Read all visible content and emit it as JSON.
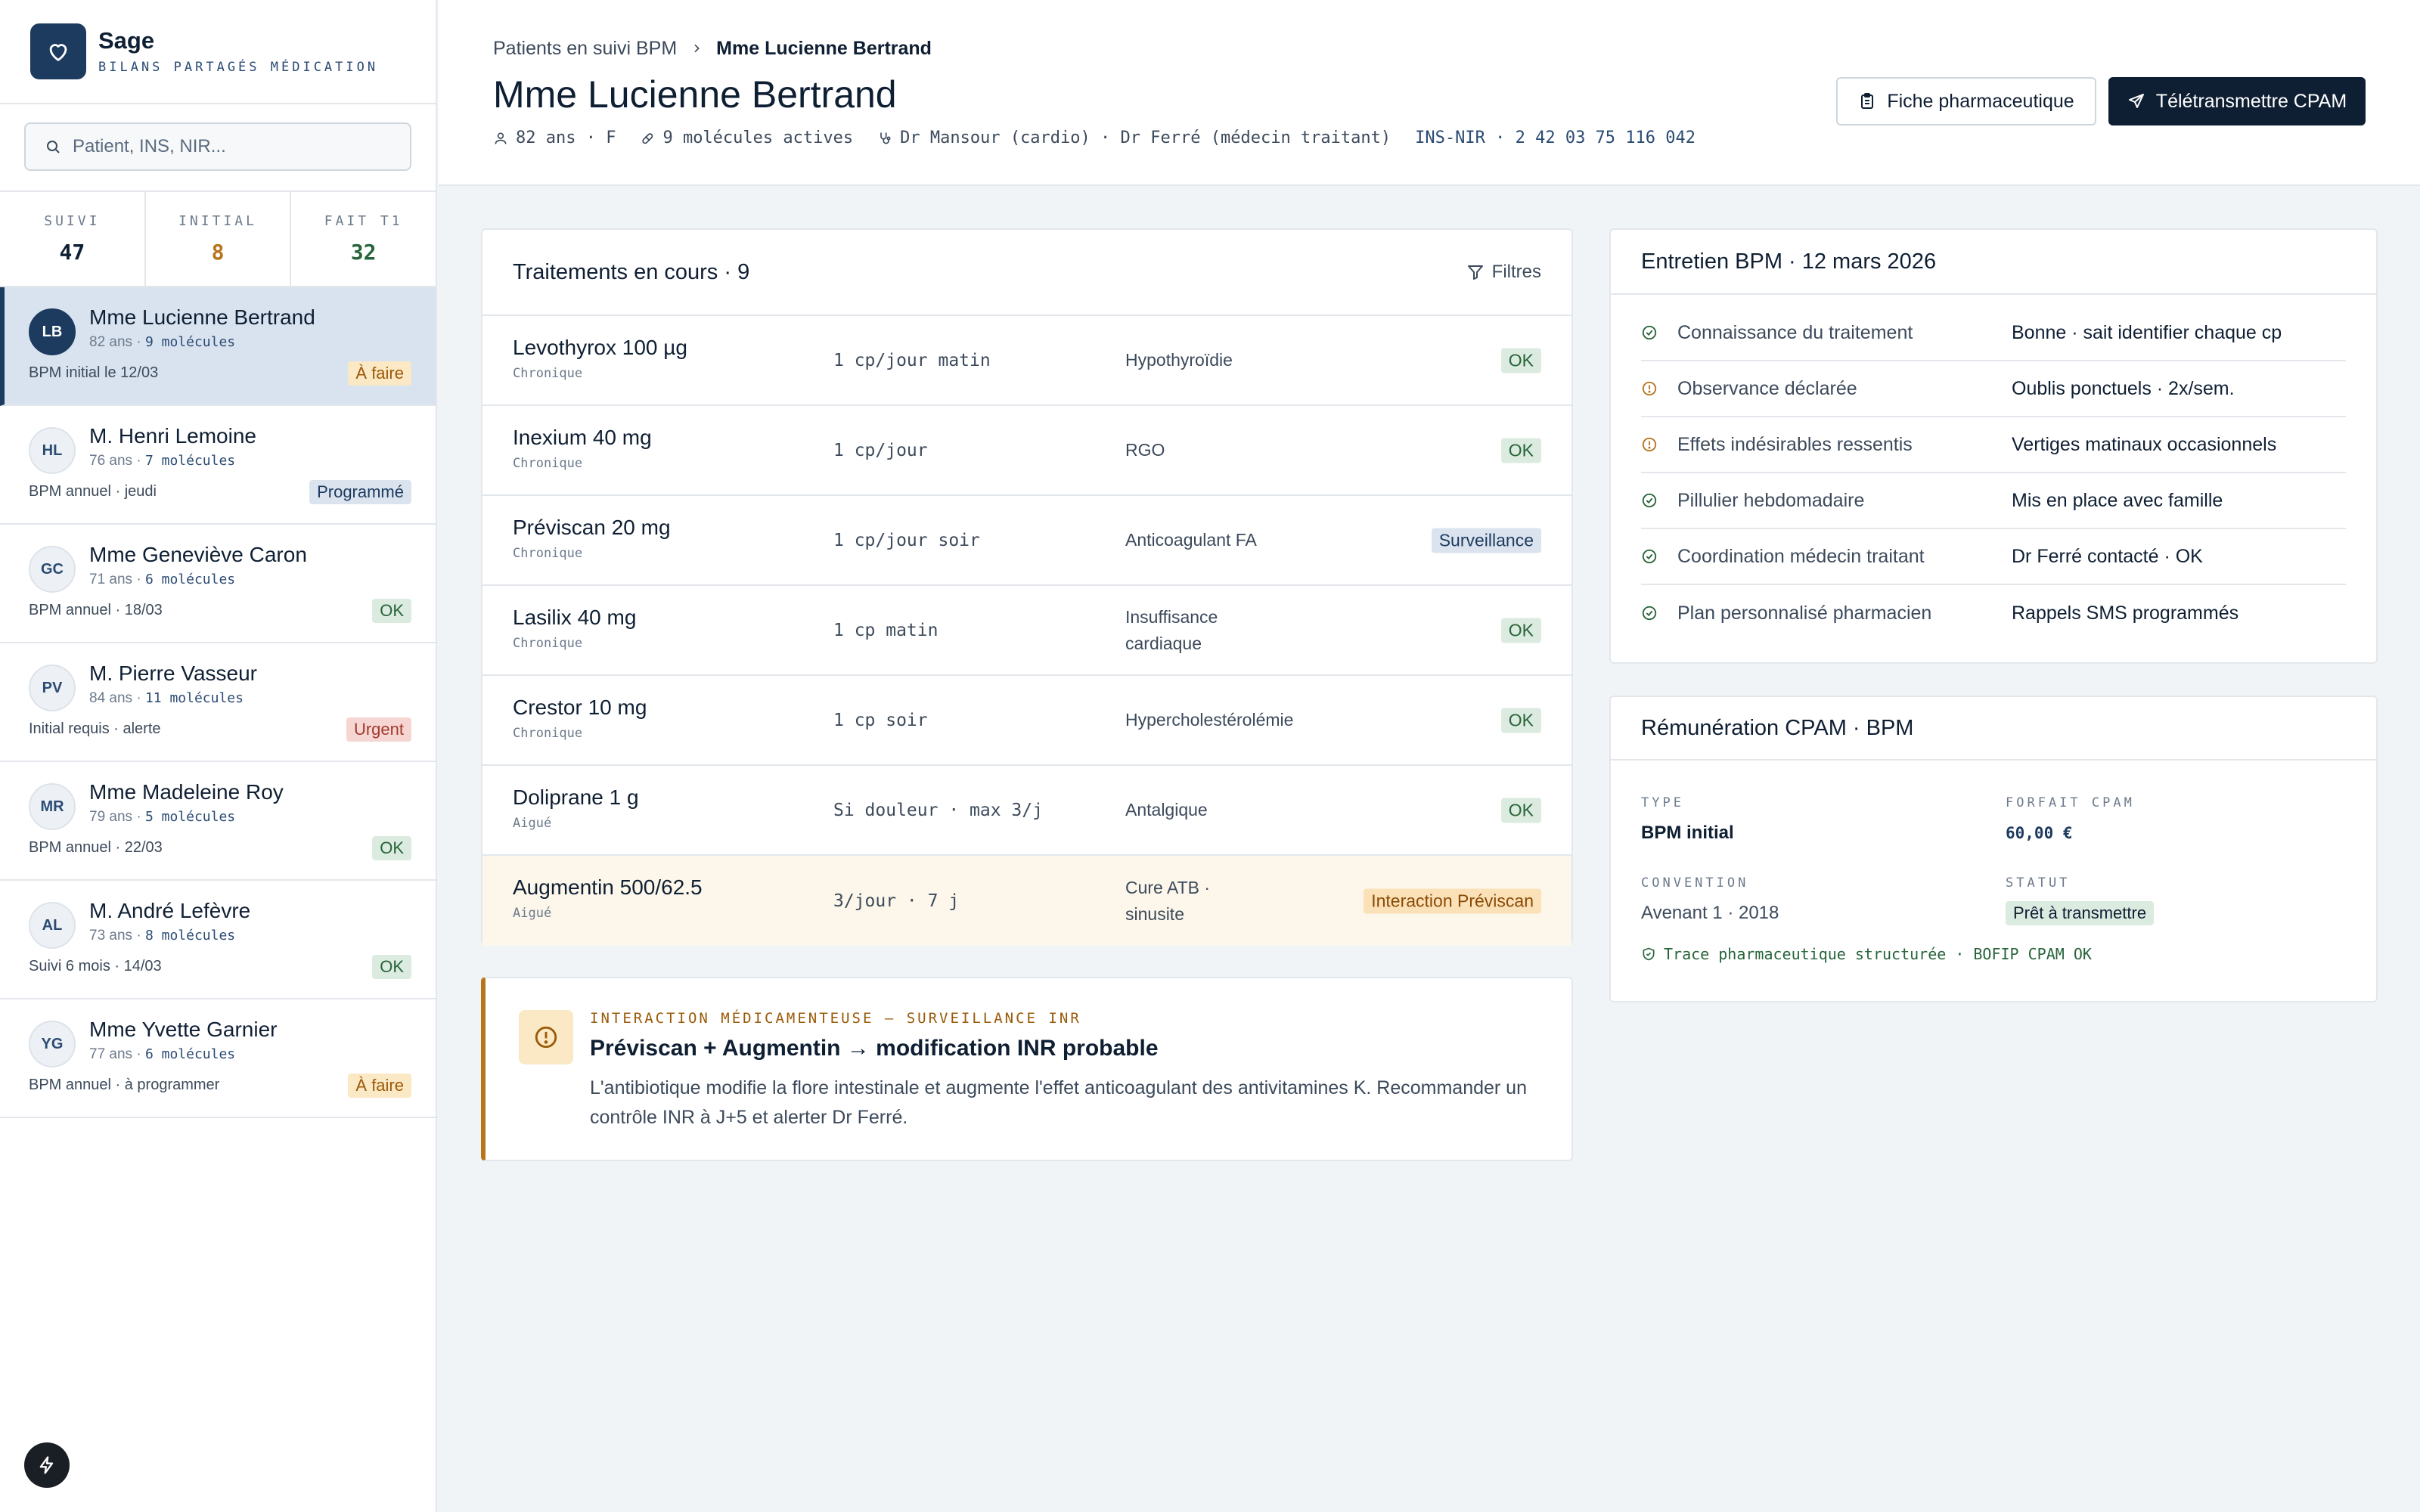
{
  "brand": {
    "name": "Sage",
    "subtitle": "BILANS PARTAGÉS MÉDICATION"
  },
  "search": {
    "placeholder": "Patient, INS, NIR..."
  },
  "stats": [
    {
      "label": "SUIVI",
      "value": "47",
      "color": "#0f1f33"
    },
    {
      "label": "INITIAL",
      "value": "8",
      "color": "#b8741a"
    },
    {
      "label": "FAIT T1",
      "value": "32",
      "color": "#27643a"
    }
  ],
  "patients": [
    {
      "initials": "LB",
      "name": "Mme Lucienne Bertrand",
      "age": "82 ans · ",
      "molecules": "9 molécules",
      "status": "BPM initial le 12/03",
      "badge": "À faire",
      "badge_type": "afaire"
    },
    {
      "initials": "HL",
      "name": "M. Henri Lemoine",
      "age": "76 ans · ",
      "molecules": "7 molécules",
      "status": "BPM annuel · jeudi",
      "badge": "Programmé",
      "badge_type": "prog"
    },
    {
      "initials": "GC",
      "name": "Mme Geneviève Caron",
      "age": "71 ans · ",
      "molecules": "6 molécules",
      "status": "BPM annuel · 18/03",
      "badge": "OK",
      "badge_type": "ok"
    },
    {
      "initials": "PV",
      "name": "M. Pierre Vasseur",
      "age": "84 ans · ",
      "molecules": "11 molécules",
      "status": "Initial requis · alerte",
      "badge": "Urgent",
      "badge_type": "urgent"
    },
    {
      "initials": "MR",
      "name": "Mme Madeleine Roy",
      "age": "79 ans · ",
      "molecules": "5 molécules",
      "status": "BPM annuel · 22/03",
      "badge": "OK",
      "badge_type": "ok"
    },
    {
      "initials": "AL",
      "name": "M. André Lefèvre",
      "age": "73 ans · ",
      "molecules": "8 molécules",
      "status": "Suivi 6 mois · 14/03",
      "badge": "OK",
      "badge_type": "ok"
    },
    {
      "initials": "YG",
      "name": "Mme Yvette Garnier",
      "age": "77 ans · ",
      "molecules": "6 molécules",
      "status": "BPM annuel · à programmer",
      "badge": "À faire",
      "badge_type": "afaire"
    }
  ],
  "header": {
    "breadcrumb_parent": "Patients en suivi BPM",
    "breadcrumb_current": "Mme Lucienne Bertrand",
    "title": "Mme Lucienne Bertrand",
    "meta_age": "82 ans · F",
    "meta_molecules": "9 molécules actives",
    "meta_doctors": "Dr Mansour (cardio) · Dr Ferré (médecin traitant)",
    "meta_ins": "INS-NIR · 2 42 03 75 116 042",
    "btn_fiche": "Fiche pharmaceutique",
    "btn_teletrans": "Télétransmettre CPAM"
  },
  "treatments": {
    "title": "Traitements en cours · 9",
    "filter_label": "Filtres",
    "rows": [
      {
        "name": "Levothyrox 100 µg",
        "kind": "Chronique",
        "dose": "1 cp/jour matin",
        "indication": "Hypothyroïdie",
        "badge": "OK",
        "badge_type": "ok"
      },
      {
        "name": "Inexium 40 mg",
        "kind": "Chronique",
        "dose": "1 cp/jour",
        "indication": "RGO",
        "badge": "OK",
        "badge_type": "ok"
      },
      {
        "name": "Préviscan 20 mg",
        "kind": "Chronique",
        "dose": "1 cp/jour soir",
        "indication": "Anticoagulant FA",
        "badge": "Surveillance",
        "badge_type": "surv"
      },
      {
        "name": "Lasilix 40 mg",
        "kind": "Chronique",
        "dose": "1 cp matin",
        "indication": "Insuffisance cardiaque",
        "badge": "OK",
        "badge_type": "ok"
      },
      {
        "name": "Crestor 10 mg",
        "kind": "Chronique",
        "dose": "1 cp soir",
        "indication": "Hypercholestérolémie",
        "badge": "OK",
        "badge_type": "ok"
      },
      {
        "name": "Doliprane 1 g",
        "kind": "Aigué",
        "dose": "Si douleur · max 3/j",
        "indication": "Antalgique",
        "badge": "OK",
        "badge_type": "ok"
      },
      {
        "name": "Augmentin 500/62.5",
        "kind": "Aigué",
        "dose": "3/jour · 7 j",
        "indication": "Cure ATB · sinusite",
        "badge": "Interaction Préviscan",
        "badge_type": "inter"
      }
    ]
  },
  "alert": {
    "kicker": "INTERACTION MÉDICAMENTEUSE — SURVEILLANCE INR",
    "title": "Préviscan + Augmentin → modification INR probable",
    "body": "L'antibiotique modifie la flore intestinale et augmente l'effet anticoagulant des antivitamines K. Recommander un contrôle INR à J+5 et alerter Dr Ferré."
  },
  "entretien": {
    "title": "Entretien BPM · 12 mars 2026",
    "rows": [
      {
        "label": "Connaissance du traitement",
        "value": "Bonne · sait identifier chaque cp",
        "status": "ok"
      },
      {
        "label": "Observance déclarée",
        "value": "Oublis ponctuels · 2x/sem.",
        "status": "warn"
      },
      {
        "label": "Effets indésirables ressentis",
        "value": "Vertiges matinaux occasionnels",
        "status": "warn"
      },
      {
        "label": "Pillulier hebdomadaire",
        "value": "Mis en place avec famille",
        "status": "ok"
      },
      {
        "label": "Coordination médecin traitant",
        "value": "Dr Ferré contacté · OK",
        "status": "ok"
      },
      {
        "label": "Plan personnalisé pharmacien",
        "value": "Rappels SMS programmés",
        "status": "ok"
      }
    ]
  },
  "remuneration": {
    "title": "Rémunération CPAM · BPM",
    "type_label": "TYPE",
    "type_value": "BPM initial",
    "forfait_label": "FORFAIT CPAM",
    "forfait_value": "60,00 €",
    "convention_label": "CONVENTION",
    "convention_value": "Avenant 1 · 2018",
    "statut_label": "STATUT",
    "statut_value": "Prêt à transmettre",
    "trace": "Trace pharmaceutique structurée · BOFIP CPAM OK"
  }
}
